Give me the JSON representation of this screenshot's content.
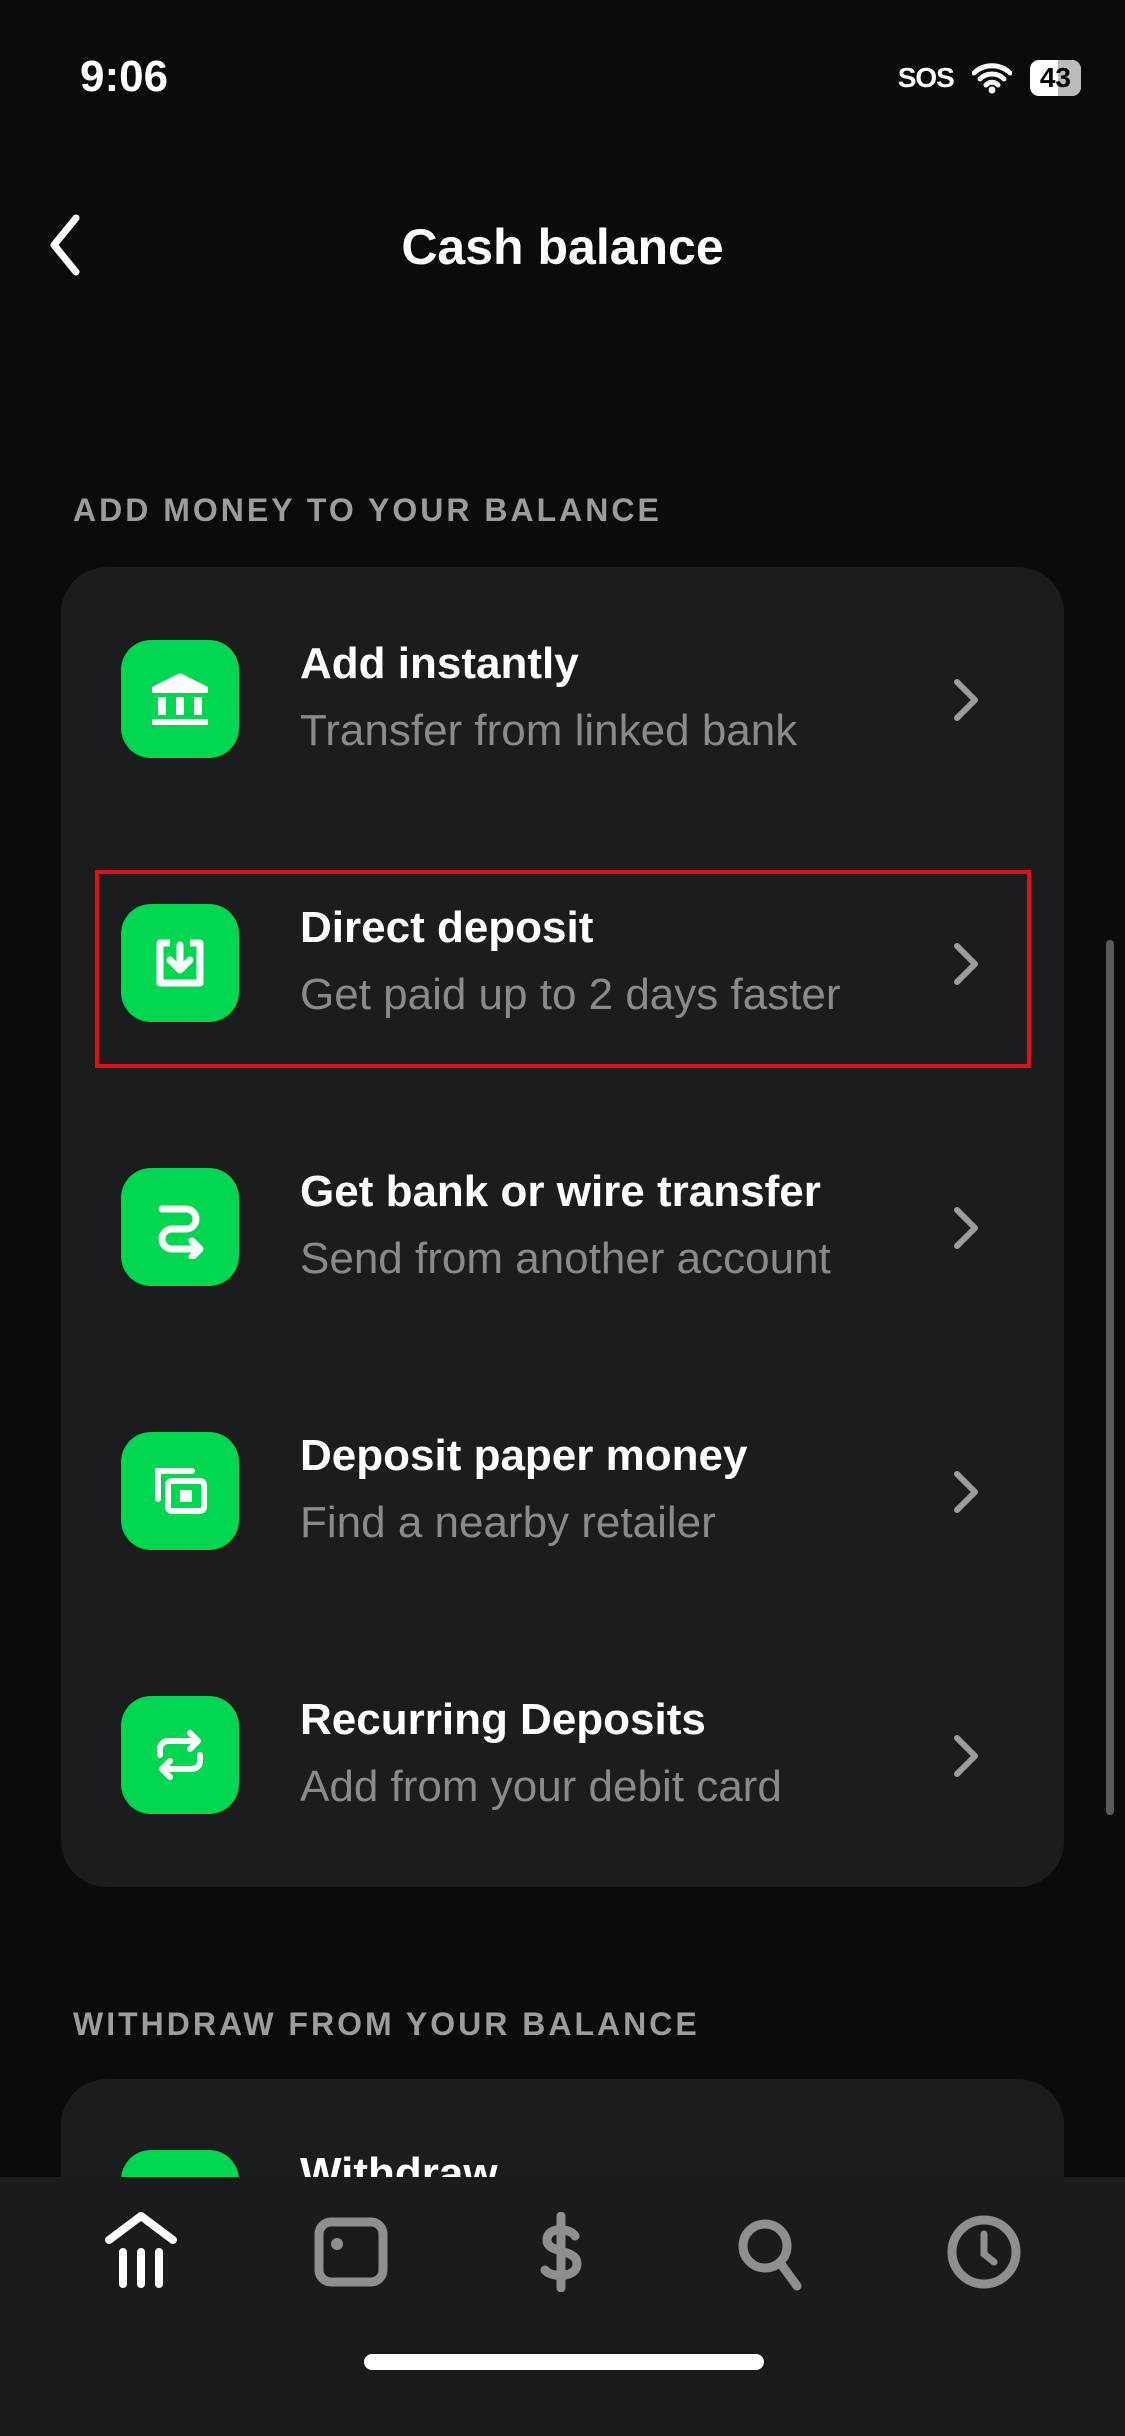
{
  "status_bar": {
    "time": "9:06",
    "sos": "SOS",
    "battery": "43"
  },
  "header": {
    "title": "Cash balance",
    "back_icon": "chevron-left-icon"
  },
  "sections": [
    {
      "label": "ADD MONEY TO YOUR BALANCE",
      "items": [
        {
          "title": "Add instantly",
          "subtitle": "Transfer from linked bank",
          "icon": "bank-icon"
        },
        {
          "title": "Direct deposit",
          "subtitle": "Get paid up to 2 days faster",
          "icon": "deposit-icon",
          "highlighted": true
        },
        {
          "title": "Get bank or wire transfer",
          "subtitle": "Send from another account",
          "icon": "transfer-arrow-icon"
        },
        {
          "title": "Deposit paper money",
          "subtitle": "Find a nearby retailer",
          "icon": "paper-money-icon"
        },
        {
          "title": "Recurring Deposits",
          "subtitle": "Add from your debit card",
          "icon": "recurring-icon"
        }
      ]
    },
    {
      "label": "WITHDRAW FROM YOUR BALANCE",
      "items": [
        {
          "title": "Withdraw"
        }
      ]
    }
  ],
  "tabbar": {
    "items": [
      "home-icon",
      "card-icon",
      "dollar-icon",
      "search-icon",
      "clock-icon"
    ],
    "active": 0
  },
  "colors": {
    "accent": "#00d64f",
    "highlight": "#e0101a",
    "card": "#1b1c1e"
  }
}
